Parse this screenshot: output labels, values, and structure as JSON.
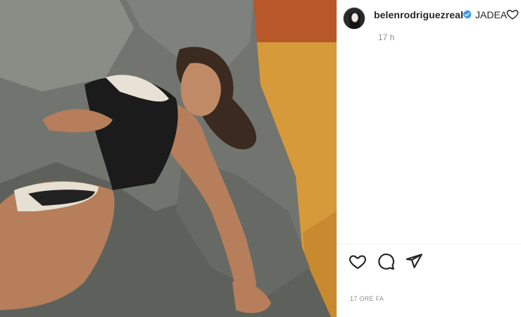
{
  "post": {
    "image_alt_icon": "photo",
    "username": "belenrodriguezreal",
    "verified_icon": "verified-badge-icon",
    "caption": "JADEA",
    "time_short": "17 h",
    "time_ago": "17 ORE FA"
  },
  "actions": {
    "like_icon": "heart-icon",
    "comment_icon": "comment-icon",
    "share_icon": "send-icon"
  },
  "colors": {
    "verified": "#3897f0",
    "text": "#262626",
    "muted": "#8e8e8e",
    "divider": "#efefef"
  }
}
